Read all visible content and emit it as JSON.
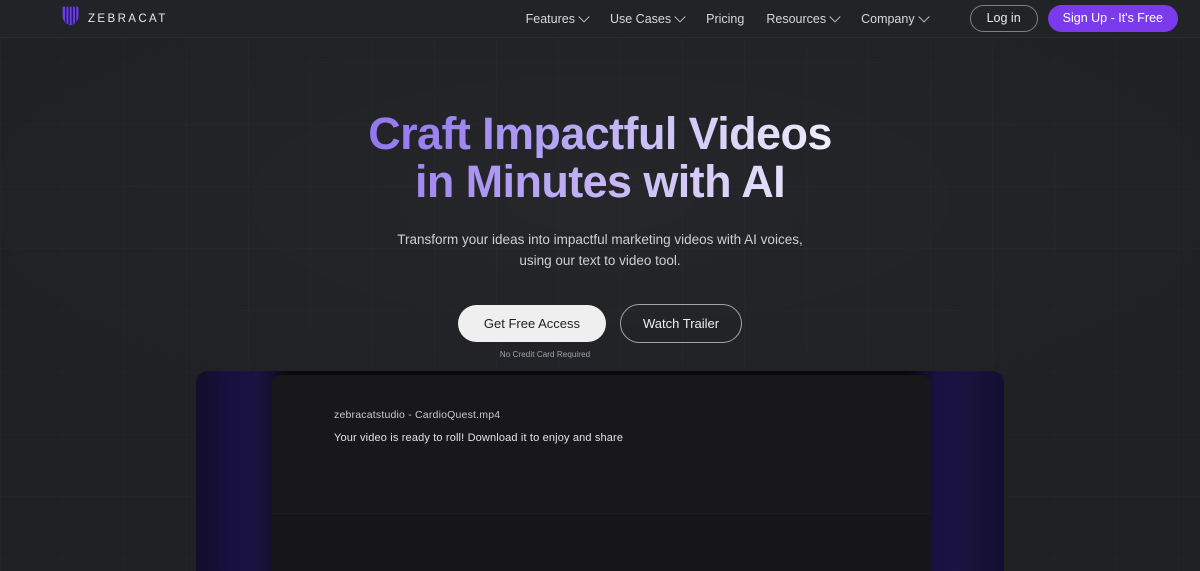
{
  "header": {
    "brand": {
      "name": "ZEBRACAT",
      "logo_icon": "zebracat-shield-icon",
      "accent": "#7c3aed"
    },
    "nav": [
      {
        "label": "Features",
        "has_dropdown": true
      },
      {
        "label": "Use Cases",
        "has_dropdown": true
      },
      {
        "label": "Pricing",
        "has_dropdown": false
      },
      {
        "label": "Resources",
        "has_dropdown": true
      },
      {
        "label": "Company",
        "has_dropdown": true
      }
    ],
    "login_label": "Log in",
    "signup_label": "Sign Up - It's Free"
  },
  "hero": {
    "headline_line_1": "Craft Impactful Videos",
    "headline_line_2": "in Minutes with AI",
    "headline_gradient_from": "#7a52e8",
    "headline_gradient_to": "#ffffff",
    "subhead_line_1": "Transform your ideas into impactful marketing videos with AI voices,",
    "subhead_line_2": "using our text to video tool.",
    "primary_cta": "Get Free Access",
    "secondary_cta": "Watch Trailer",
    "cta_note": "No Credit Card Required"
  },
  "showcase": {
    "video_filename": "zebracatstudio - CardioQuest.mp4",
    "video_status": "Your video is ready to roll! Download it to enjoy and share"
  }
}
